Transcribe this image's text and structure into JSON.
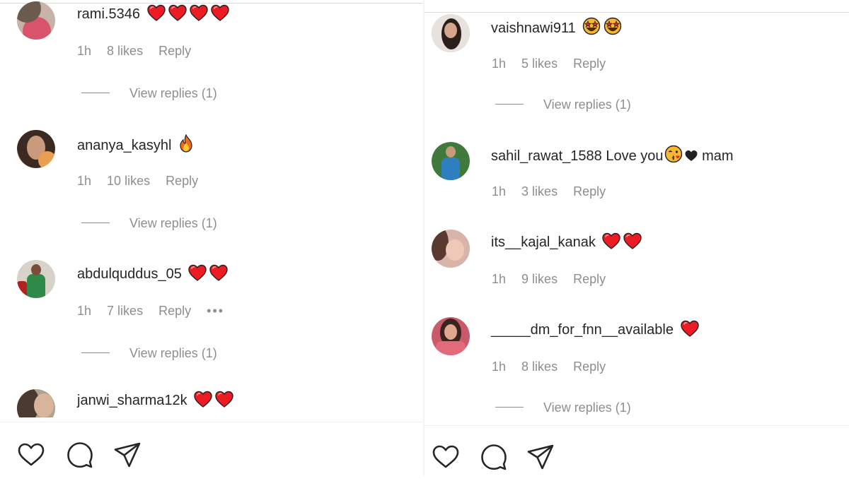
{
  "left": {
    "comments": [
      {
        "username": "rami.5346",
        "text": "",
        "meta": {
          "time": "1h",
          "likes": "8 likes",
          "reply": "Reply"
        },
        "replies": "View replies (1)",
        "emoji": [
          "heart",
          "heart",
          "heart",
          "heart"
        ]
      },
      {
        "username": "ananya_kasyhl",
        "text": "",
        "meta": {
          "time": "1h",
          "likes": "10 likes",
          "reply": "Reply"
        },
        "replies": "View replies (1)",
        "emoji": [
          "fire"
        ]
      },
      {
        "username": "abdulquddus_05",
        "text": "",
        "meta": {
          "time": "1h",
          "likes": "7 likes",
          "reply": "Reply",
          "more": "•••"
        },
        "replies": "View replies (1)",
        "emoji": [
          "heart",
          "heart"
        ]
      },
      {
        "username": "janwi_sharma12k",
        "text": "",
        "emoji": [
          "heart",
          "heart"
        ]
      }
    ]
  },
  "right": {
    "comments": [
      {
        "username": "vaishnawi911",
        "text": "",
        "meta": {
          "time": "1h",
          "likes": "5 likes",
          "reply": "Reply"
        },
        "replies": "View replies (1)",
        "emoji": [
          "star-eyes",
          "star-eyes"
        ]
      },
      {
        "username": "sahil_rawat_1588",
        "text": " Love you",
        "text2": " mam",
        "meta": {
          "time": "1h",
          "likes": "3 likes",
          "reply": "Reply"
        },
        "emoji": [
          "kiss",
          "black-heart"
        ]
      },
      {
        "username": "its__kajal_kanak",
        "text": "",
        "meta": {
          "time": "1h",
          "likes": "9 likes",
          "reply": "Reply"
        },
        "emoji": [
          "heart",
          "heart"
        ]
      },
      {
        "username": "_____dm_for_fnn__available",
        "text": "",
        "meta": {
          "time": "1h",
          "likes": "8 likes",
          "reply": "Reply"
        },
        "replies": "View replies (1)",
        "emoji": [
          "heart"
        ]
      }
    ]
  },
  "icons": [
    "heart-outline-icon",
    "comment-bubble-icon",
    "share-paper-plane-icon"
  ],
  "colors": {
    "meta": "#8e8e8e",
    "text": "#262626",
    "heart": "#ed1c24"
  }
}
